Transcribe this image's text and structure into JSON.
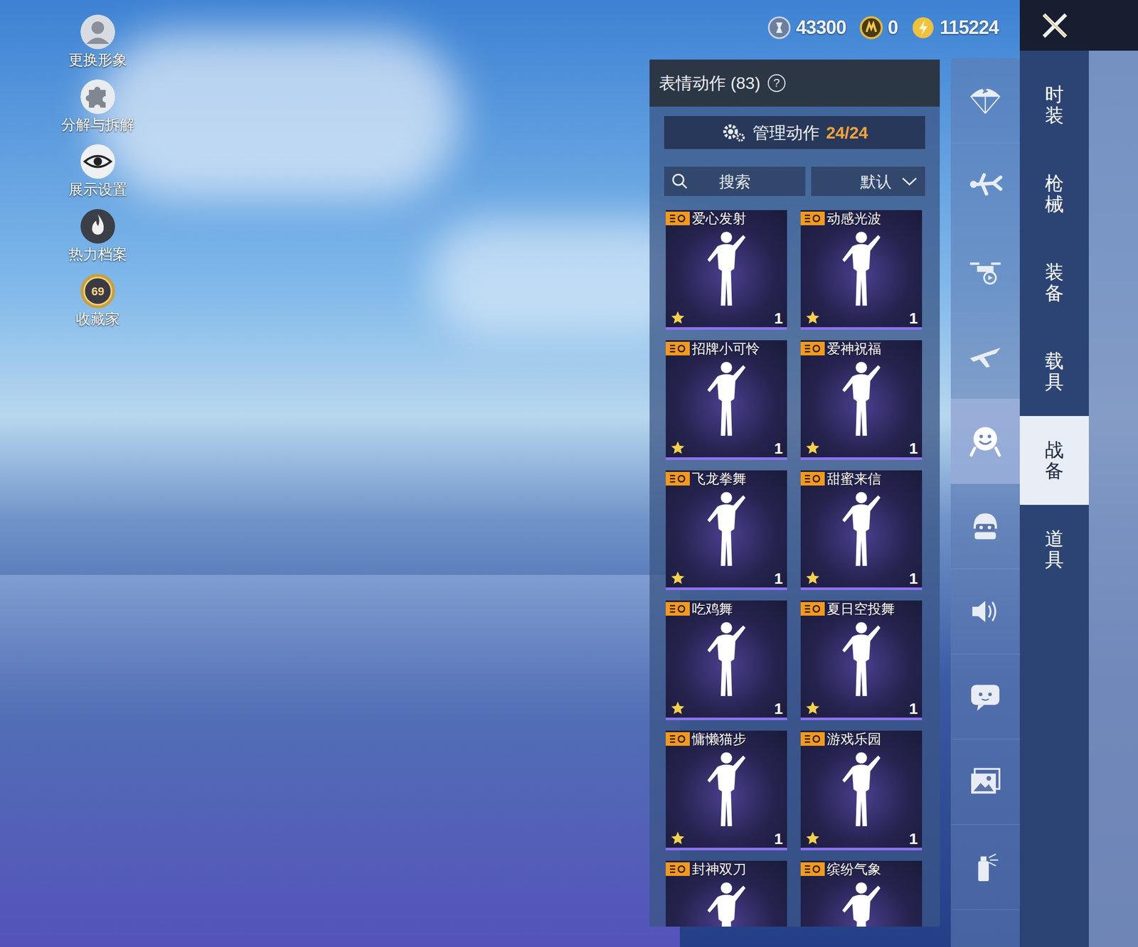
{
  "profile_menu": [
    {
      "label": "更换形象",
      "kind": "avatar"
    },
    {
      "label": "分解与拆解",
      "kind": "puzzle"
    },
    {
      "label": "展示设置",
      "kind": "eye"
    },
    {
      "label": "热力档案",
      "kind": "flame"
    },
    {
      "label": "收藏家",
      "kind": "badge",
      "badge": "69"
    }
  ],
  "currencies": [
    {
      "value": "43300",
      "kind": "silver"
    },
    {
      "value": "0",
      "kind": "gold"
    },
    {
      "value": "115224",
      "kind": "coupon"
    }
  ],
  "panel": {
    "title": "表情动作 (83)",
    "help": "?",
    "manage": {
      "label": "管理动作",
      "count": "24/24"
    },
    "search": {
      "placeholder": "搜索"
    },
    "sort": {
      "label": "默认"
    }
  },
  "emotes": [
    {
      "name": "爱心发射",
      "count": "1"
    },
    {
      "name": "动感光波",
      "count": "1"
    },
    {
      "name": "招牌小可怜",
      "count": "1"
    },
    {
      "name": "爱神祝福",
      "count": "1"
    },
    {
      "name": "飞龙拳舞",
      "count": "1"
    },
    {
      "name": "甜蜜来信",
      "count": "1"
    },
    {
      "name": "吃鸡舞",
      "count": "1"
    },
    {
      "name": "夏日空投舞",
      "count": "1"
    },
    {
      "name": "慵懒猫步",
      "count": "1"
    },
    {
      "name": "游戏乐园",
      "count": "1"
    },
    {
      "name": "封神双刀"
    },
    {
      "name": "缤纷气象"
    }
  ],
  "categories": [
    {
      "kind": "parachute",
      "selected": false
    },
    {
      "kind": "skydive",
      "selected": false
    },
    {
      "kind": "drone",
      "selected": false
    },
    {
      "kind": "plane",
      "selected": false
    },
    {
      "kind": "emote",
      "selected": true
    },
    {
      "kind": "helmet",
      "selected": false
    },
    {
      "kind": "speaker",
      "selected": false
    },
    {
      "kind": "chat",
      "selected": false
    },
    {
      "kind": "gallery",
      "selected": false
    },
    {
      "kind": "spray",
      "selected": false
    }
  ],
  "tabs": [
    {
      "label": "时装",
      "selected": false
    },
    {
      "label": "枪械",
      "selected": false
    },
    {
      "label": "装备",
      "selected": false
    },
    {
      "label": "载具",
      "selected": false
    },
    {
      "label": "战备",
      "selected": true
    },
    {
      "label": "道具",
      "selected": false
    }
  ]
}
